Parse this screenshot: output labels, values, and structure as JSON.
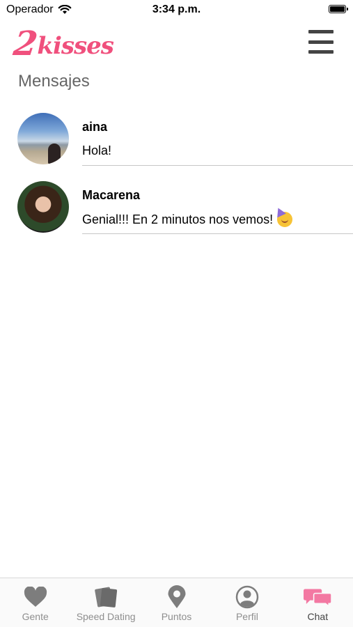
{
  "status_bar": {
    "carrier": "Operador",
    "time": "3:34 p.m."
  },
  "header": {
    "logo_two": "2",
    "logo_word": "kisses",
    "logo_color": "#f0507d"
  },
  "page": {
    "title": "Mensajes"
  },
  "conversations": [
    {
      "name": "aina",
      "preview": "Hola!"
    },
    {
      "name": "Macarena",
      "preview": "Genial!!! En 2 minutos nos vemos!",
      "emoji": "party-face-icon"
    }
  ],
  "tab_bar": {
    "items": [
      {
        "label": "Gente",
        "icon": "heart-icon"
      },
      {
        "label": "Speed Dating",
        "icon": "cards-icon"
      },
      {
        "label": "Puntos",
        "icon": "location-pin-icon"
      },
      {
        "label": "Perfil",
        "icon": "profile-icon"
      },
      {
        "label": "Chat",
        "icon": "chat-bubbles-icon",
        "active": true
      }
    ],
    "active_color": "#f378a2",
    "inactive_color": "#7d7d7d"
  }
}
